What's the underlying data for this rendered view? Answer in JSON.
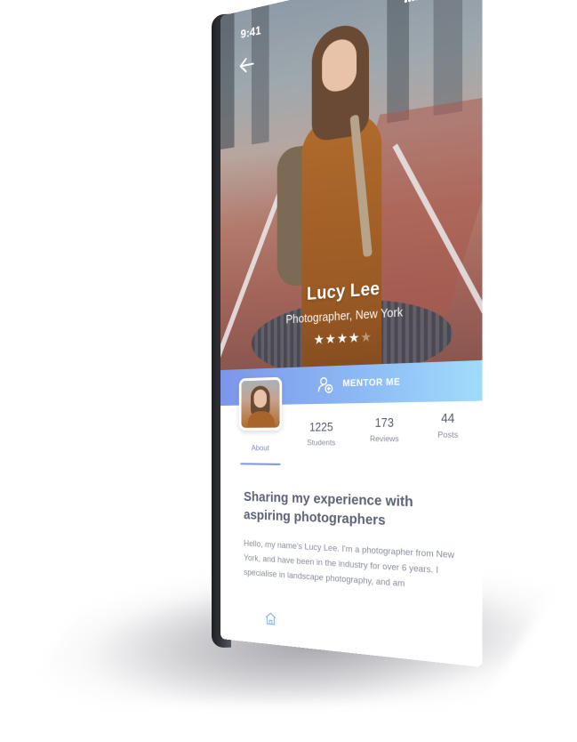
{
  "status_bar": {
    "time": "9:41"
  },
  "profile": {
    "name": "Lucy Lee",
    "role": "Photographer, New York",
    "rating": 4,
    "rating_max": 5
  },
  "mentor_button": {
    "label": "MENTOR ME"
  },
  "stats": [
    {
      "value": "1225",
      "label": "Students"
    },
    {
      "value": "173",
      "label": "Reviews"
    },
    {
      "value": "44",
      "label": "Posts"
    }
  ],
  "tabs": {
    "active": "About"
  },
  "about": {
    "title": "Sharing my experience with aspiring photographers",
    "body": "Hello, my name's Lucy Lee. I'm a photographer from New York, and have been in the industry for over 6 years. I specialise in landscape photography, and am"
  },
  "colors": {
    "accent_start": "#7c96ea",
    "accent_end": "#9fdcfb",
    "title_text": "#5d6275",
    "body_text": "#8a8e9c"
  },
  "icons": {
    "back": "arrow-left-icon",
    "mentor": "person-plus-icon",
    "home": "home-icon"
  }
}
